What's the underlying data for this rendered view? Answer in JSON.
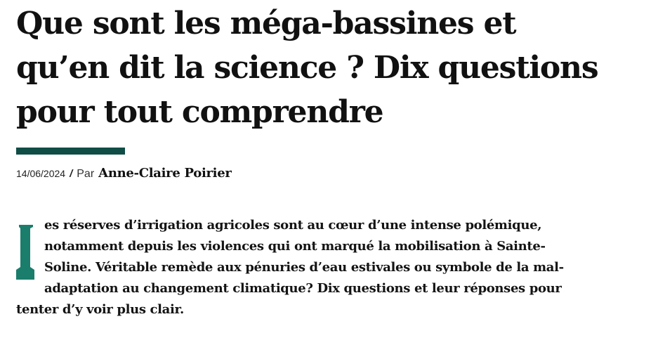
{
  "article": {
    "title_lines": [
      "Que sont les méga-bassines et",
      "qu’en dit la science ? Dix questions",
      "pour tout comprendre"
    ],
    "byline": {
      "date": "14/06/2024",
      "separator": "/",
      "prefix": "Par",
      "author": "Anne-Claire Poirier"
    },
    "intro": {
      "drop_cap": "L",
      "lines": [
        "es réserves d’irrigation agricoles sont au cœur d’une intense polémique,",
        "notamment depuis les violences qui ont marqué la mobilisation à Sainte-",
        "Soline. Véritable remède aux pénuries d’eau estivales ou symbole de la mal-",
        "adaptation au changement climatique? Dix questions et leur réponses pour",
        "tenter d’y voir plus clair."
      ]
    },
    "accent_color": "#0f4d46",
    "drop_cap_color": "#1b7d6c"
  }
}
